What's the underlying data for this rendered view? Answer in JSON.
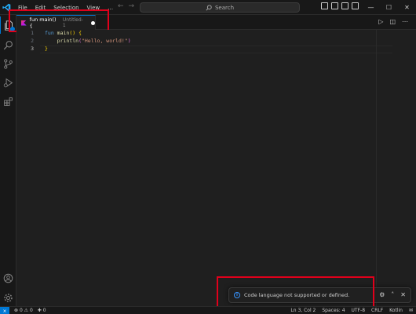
{
  "titlebar": {
    "menu": [
      "File",
      "Edit",
      "Selection",
      "View",
      "…"
    ],
    "search_label": "Search"
  },
  "tab": {
    "name": "fun main() {",
    "description": "Untitled-1"
  },
  "editor": {
    "lines": [
      {
        "num": "1"
      },
      {
        "num": "2"
      },
      {
        "num": "3"
      }
    ],
    "code": {
      "l1_kw": "fun",
      "l1_fn": "main",
      "l1_parens": "()",
      "l1_brace": "{",
      "l2_fn": "println",
      "l2_open": "(",
      "l2_str": "\"Hello, world!\"",
      "l2_close": ")",
      "l3_brace": "}"
    }
  },
  "notification": {
    "message": "Code language not supported or defined."
  },
  "statusbar": {
    "remote": "⨯",
    "errors": "0",
    "warnings": "0",
    "ports": "0",
    "position": "Ln 3, Col 2",
    "spaces": "Spaces: 4",
    "encoding": "UTF-8",
    "eol": "CRLF",
    "language": "Kotlin"
  },
  "colors": {
    "accent": "#0078d4",
    "highlight": "#e0001b",
    "background": "#1f1f1f"
  }
}
